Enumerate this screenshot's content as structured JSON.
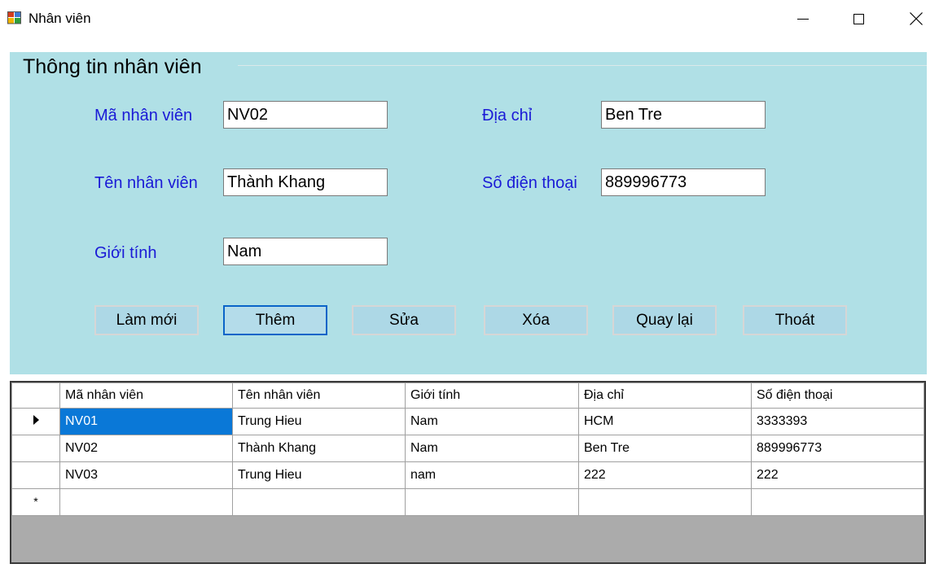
{
  "window": {
    "title": "Nhân viên",
    "icon": "winforms-app-icon",
    "minimize_icon": "minimize-icon",
    "maximize_icon": "maximize-icon",
    "close_icon": "close-icon"
  },
  "group": {
    "title": "Thông tin nhân viên",
    "background": "#b0e0e6"
  },
  "form": {
    "ma_label": "Mã nhân viên",
    "ma_value": "NV02",
    "ten_label": "Tên nhân viên",
    "ten_value": "Thành Khang",
    "gioitinh_label": "Giới tính",
    "gioitinh_value": "Nam",
    "diachi_label": "Địa chỉ",
    "diachi_value": "Ben Tre",
    "sdt_label": "Số điện thoại",
    "sdt_value": "889996773",
    "label_color": "#1a1ad6"
  },
  "buttons": {
    "lammoi": "Làm mới",
    "them": "Thêm",
    "sua": "Sửa",
    "xoa": "Xóa",
    "quaylai": "Quay lại",
    "thoat": "Thoát"
  },
  "grid": {
    "columns": [
      "Mã nhân viên",
      "Tên nhân viên",
      "Giới tính",
      "Địa chỉ",
      "Số điện thoại"
    ],
    "rows": [
      [
        "NV01",
        "Trung Hieu",
        "Nam",
        "HCM",
        "3333393"
      ],
      [
        "NV02",
        "Thành Khang",
        "Nam",
        "Ben Tre",
        "889996773"
      ],
      [
        "NV03",
        "Trung Hieu",
        "nam",
        "222",
        "222"
      ]
    ],
    "current_row_icon": "current-row-arrow-icon",
    "new_row_marker": "*",
    "selection_color": "#0a78d7"
  }
}
